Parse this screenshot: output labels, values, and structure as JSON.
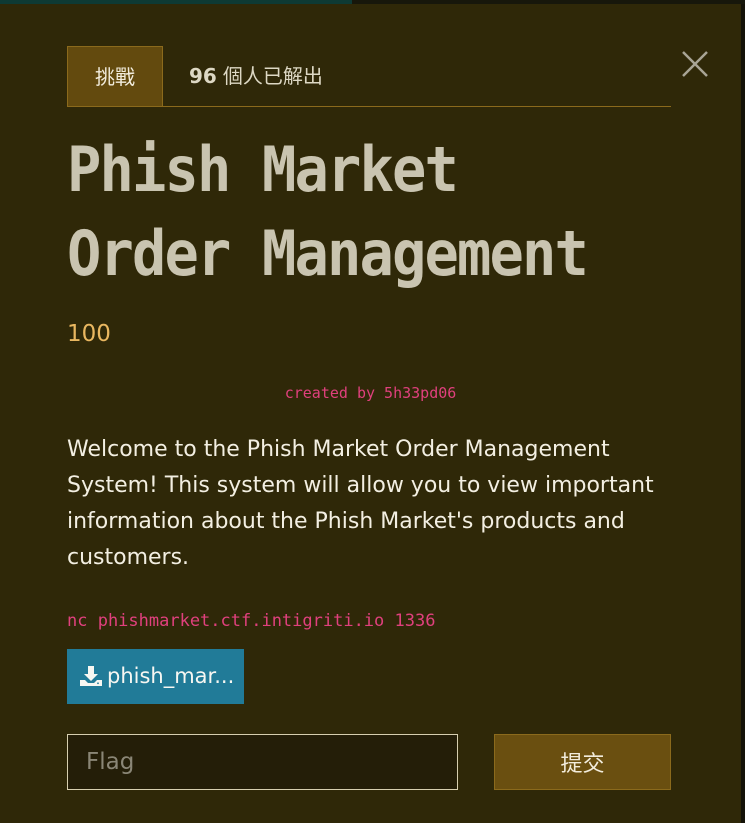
{
  "colors": {
    "background": "#2f2808",
    "accent": "#634a0e",
    "points": "#e9b760",
    "code": "#e0407d",
    "file_button": "#217b98"
  },
  "tabs": {
    "challenge_label": "挑戰",
    "solves_count": "96",
    "solves_text": "個人已解出"
  },
  "challenge": {
    "title": "Phish Market Order Management",
    "points": "100",
    "author": "created by 5h33pd06",
    "description": "Welcome to the Phish Market Order Management System! This system will allow you to view important information about the Phish Market's products and customers.",
    "connection": "nc phishmarket.ctf.intigriti.io 1336"
  },
  "files": [
    {
      "label": "phish_mar...",
      "icon": "download-icon"
    }
  ],
  "submission": {
    "placeholder": "Flag",
    "submit_label": "提交"
  },
  "icons": {
    "close": "close-icon"
  }
}
